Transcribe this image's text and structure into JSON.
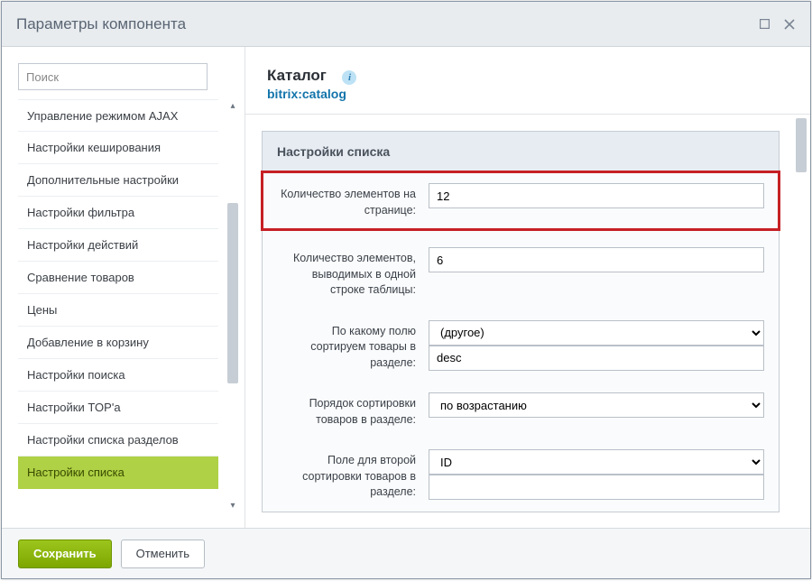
{
  "window": {
    "title": "Параметры компонента"
  },
  "sidebar": {
    "searchPlaceholder": "Поиск",
    "items": [
      "Управление режимом AJAX",
      "Настройки кеширования",
      "Дополнительные настройки",
      "Настройки фильтра",
      "Настройки действий",
      "Сравнение товаров",
      "Цены",
      "Добавление в корзину",
      "Настройки поиска",
      "Настройки TOP'а",
      "Настройки списка разделов",
      "Настройки списка"
    ],
    "activeIndex": 11
  },
  "header": {
    "title": "Каталог",
    "component": "bitrix:catalog"
  },
  "section": {
    "title": "Настройки списка",
    "fields": {
      "pageCount": {
        "label": "Количество элементов на странице:",
        "value": "12"
      },
      "rowCount": {
        "label": "Количество элементов, выводимых в одной строке таблицы:",
        "value": "6"
      },
      "sortField": {
        "label": "По какому полю сортируем товары в разделе:",
        "selectValue": "(другое)",
        "inputValue": "desc"
      },
      "sortOrder": {
        "label": "Порядок сортировки товаров в разделе:",
        "selectValue": "по возрастанию"
      },
      "sortField2": {
        "label": "Поле для второй сортировки товаров в разделе:",
        "selectValue": "ID",
        "inputValue": ""
      }
    }
  },
  "footer": {
    "save": "Сохранить",
    "cancel": "Отменить"
  }
}
